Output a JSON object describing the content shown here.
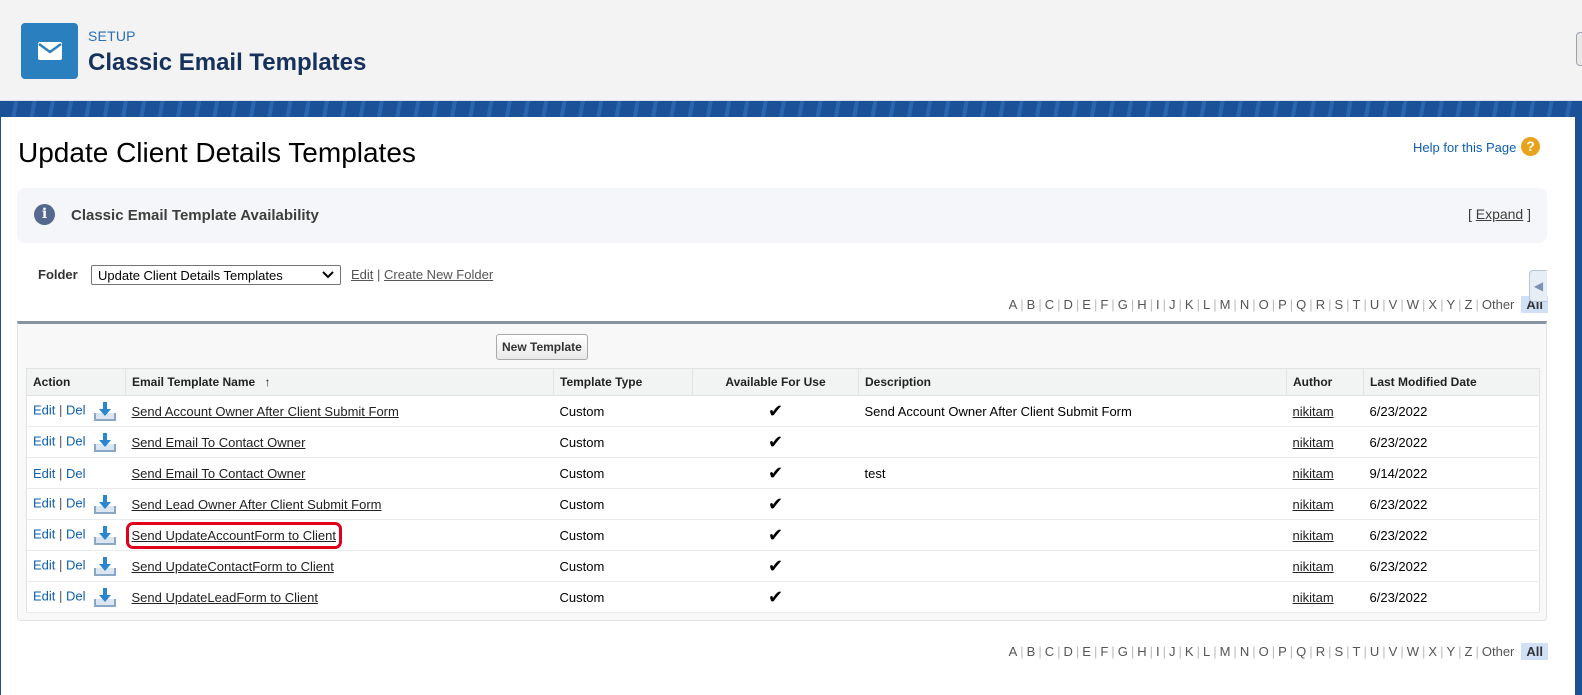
{
  "header": {
    "setup_label": "SETUP",
    "title": "Classic Email Templates",
    "icon": "envelope-icon"
  },
  "page": {
    "title": "Update Client Details Templates",
    "help_link": "Help for this Page"
  },
  "availability": {
    "title": "Classic Email Template Availability",
    "bracket_open": "[",
    "expand_label": "Expand",
    "bracket_close": "]"
  },
  "folder": {
    "label": "Folder",
    "selected": "Update Client Details Templates",
    "edit_label": "Edit",
    "separator": "|",
    "create_label": "Create New Folder"
  },
  "alphabet": [
    "A",
    "B",
    "C",
    "D",
    "E",
    "F",
    "G",
    "H",
    "I",
    "J",
    "K",
    "L",
    "M",
    "N",
    "O",
    "P",
    "Q",
    "R",
    "S",
    "T",
    "U",
    "V",
    "W",
    "X",
    "Y",
    "Z",
    "Other"
  ],
  "alphabet_all": "All",
  "list": {
    "new_template_label": "New Template",
    "columns": {
      "action": "Action",
      "name": "Email Template Name",
      "sort_indicator": "↑",
      "type": "Template Type",
      "available": "Available For Use",
      "description": "Description",
      "author": "Author",
      "modified": "Last Modified Date"
    },
    "action_edit": "Edit",
    "action_sep": "|",
    "action_del": "Del",
    "check_glyph": "✔",
    "rows": [
      {
        "name": "Send Account Owner After Client Submit Form",
        "type": "Custom",
        "available": true,
        "description": "Send Account Owner After Client Submit Form",
        "author": "nikitam",
        "modified": "6/23/2022",
        "download": true,
        "highlight": false
      },
      {
        "name": "Send Email To Contact Owner",
        "type": "Custom",
        "available": true,
        "description": "",
        "author": "nikitam",
        "modified": "6/23/2022",
        "download": true,
        "highlight": false
      },
      {
        "name": "Send Email To Contact Owner",
        "type": "Custom",
        "available": true,
        "description": "test",
        "author": "nikitam",
        "modified": "9/14/2022",
        "download": false,
        "highlight": false
      },
      {
        "name": "Send Lead Owner After Client Submit Form",
        "type": "Custom",
        "available": true,
        "description": "",
        "author": "nikitam",
        "modified": "6/23/2022",
        "download": true,
        "highlight": false
      },
      {
        "name": "Send UpdateAccountForm to Client",
        "type": "Custom",
        "available": true,
        "description": "",
        "author": "nikitam",
        "modified": "6/23/2022",
        "download": true,
        "highlight": true
      },
      {
        "name": "Send UpdateContactForm to Client",
        "type": "Custom",
        "available": true,
        "description": "",
        "author": "nikitam",
        "modified": "6/23/2022",
        "download": true,
        "highlight": false
      },
      {
        "name": "Send UpdateLeadForm to Client",
        "type": "Custom",
        "available": true,
        "description": "",
        "author": "nikitam",
        "modified": "6/23/2022",
        "download": true,
        "highlight": false
      }
    ]
  },
  "colors": {
    "brand_blue": "#1b5297",
    "icon_blue": "#2a7fbf",
    "link_blue": "#0e5fb0",
    "highlight_red": "#e0001b",
    "help_orange": "#e8a21c"
  }
}
